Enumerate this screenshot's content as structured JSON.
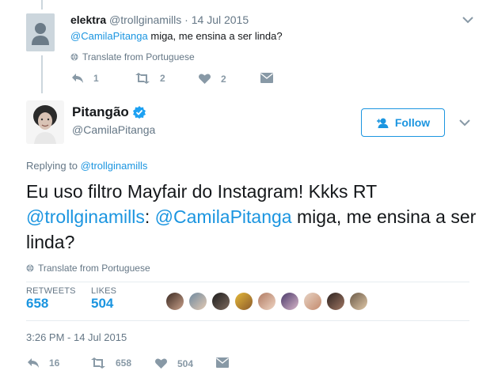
{
  "reply_tweet": {
    "display_name": "elektra",
    "handle": "@trollginamills",
    "separator": "·",
    "date": "14 Jul 2015",
    "mention": "@CamilaPitanga",
    "text_rest": " miga, me ensina a ser linda?",
    "translate": "Translate from Portuguese",
    "reply_count": "1",
    "retweet_count": "2",
    "like_count": "2"
  },
  "main_tweet": {
    "display_name": "Pitangão",
    "handle": "@CamilaPitanga",
    "follow_label": "Follow",
    "replying_prefix": "Replying to ",
    "replying_to": "@trollginamills",
    "text_part1": "Eu uso filtro Mayfair do Instagram! Kkks RT",
    "text_mention1": "@trollginamills",
    "text_colon": ": ",
    "text_mention2": "@CamilaPitanga",
    "text_part2": " miga, me ensina a ser linda?",
    "translate": "Translate from Portuguese",
    "retweets_label": "RETWEETS",
    "retweets_value": "658",
    "likes_label": "LIKES",
    "likes_value": "504",
    "timestamp": "3:26 PM - 14 Jul 2015",
    "reply_count": "16",
    "retweet_count": "658",
    "like_count": "504"
  },
  "colors": {
    "accent": "#1b95e0",
    "verified": "#1da1f2",
    "secondary_text": "#657786",
    "icon": "#8899a6"
  },
  "icons": [
    "chevron-down-icon",
    "globe-icon",
    "reply-icon",
    "retweet-icon",
    "heart-icon",
    "dm-icon",
    "follow-user-icon",
    "verified-badge-icon"
  ]
}
